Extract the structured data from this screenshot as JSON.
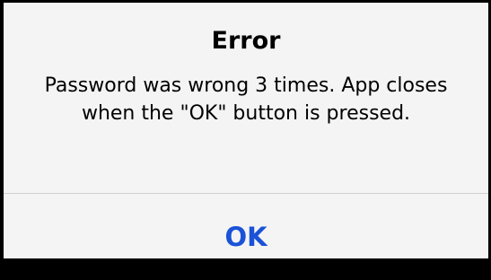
{
  "alert": {
    "title": "Error",
    "message": "Password was wrong 3 times. App closes when the \"OK\" button is pressed.",
    "ok_label": "OK"
  },
  "colors": {
    "backdrop": "#000000",
    "alert_background": "#f4f4f4",
    "divider": "#d0d0d0",
    "button_text": "#1a52d8"
  }
}
